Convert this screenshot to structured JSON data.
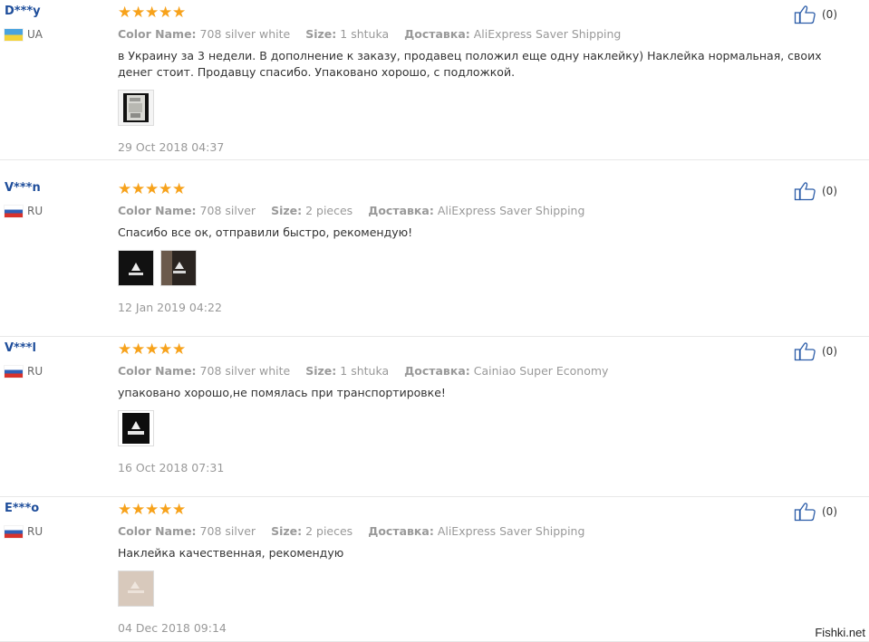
{
  "reviews": [
    {
      "user": "D***y",
      "country": "UA",
      "rating": 5,
      "attrs": [
        {
          "label": "Color Name:",
          "value": "708 silver white"
        },
        {
          "label": "Size:",
          "value": "1 shtuka"
        },
        {
          "label": "Доставка:",
          "value": "AliExpress Saver Shipping"
        }
      ],
      "text": "в Украину за 3 недели. В дополнение к заказу, продавец положил еще одну наклейку) Наклейка нормальная, своих денег стоит. Продавцу спасибо. Упаковано хорошо, с подложкой.",
      "photos": 1,
      "date": "29 Oct 2018 04:37",
      "helpful": "(0)"
    },
    {
      "user": "V***n",
      "country": "RU",
      "rating": 5,
      "attrs": [
        {
          "label": "Color Name:",
          "value": "708 silver"
        },
        {
          "label": "Size:",
          "value": "2 pieces"
        },
        {
          "label": "Доставка:",
          "value": "AliExpress Saver Shipping"
        }
      ],
      "text": "Спасибо все ок, отправили быстро, рекомендую!",
      "photos": 2,
      "date": "12 Jan 2019 04:22",
      "helpful": "(0)"
    },
    {
      "user": "V***l",
      "country": "RU",
      "rating": 5,
      "attrs": [
        {
          "label": "Color Name:",
          "value": "708 silver white"
        },
        {
          "label": "Size:",
          "value": "1 shtuka"
        },
        {
          "label": "Доставка:",
          "value": "Cainiao Super Economy"
        }
      ],
      "text": "упаковано хорошо,не помялась при транспортировке!",
      "photos": 1,
      "date": "16 Oct 2018 07:31",
      "helpful": "(0)"
    },
    {
      "user": "E***o",
      "country": "RU",
      "rating": 5,
      "attrs": [
        {
          "label": "Color Name:",
          "value": "708 silver"
        },
        {
          "label": "Size:",
          "value": "2 pieces"
        },
        {
          "label": "Доставка:",
          "value": "AliExpress Saver Shipping"
        }
      ],
      "text": "Наклейка качественная, рекомендую",
      "photos": 1,
      "date": "04 Dec 2018 09:14",
      "helpful": "(0)"
    }
  ],
  "watermark": "Fishki.net",
  "colors": {
    "username": "#1f4e9b",
    "star": "#f7a21b",
    "muted": "#999999",
    "text": "#333333",
    "like_icon": "#2b5ca8"
  }
}
